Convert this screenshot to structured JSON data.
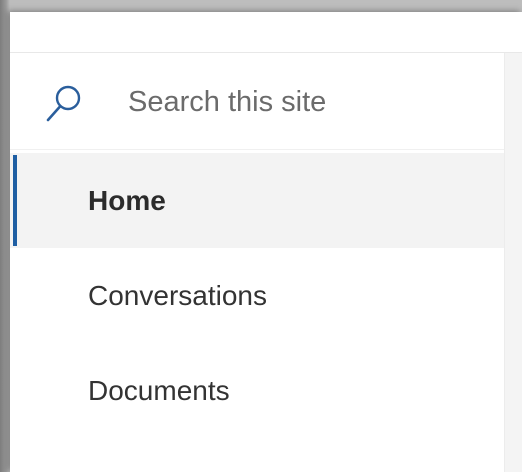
{
  "search": {
    "placeholder": "Search this site",
    "icon": "search-icon"
  },
  "nav": {
    "items": [
      {
        "label": "Home",
        "active": true
      },
      {
        "label": "Conversations",
        "active": false
      },
      {
        "label": "Documents",
        "active": false
      }
    ]
  },
  "colors": {
    "accent": "#1e5ea3",
    "active_background": "#f3f3f3",
    "text": "#333333"
  }
}
